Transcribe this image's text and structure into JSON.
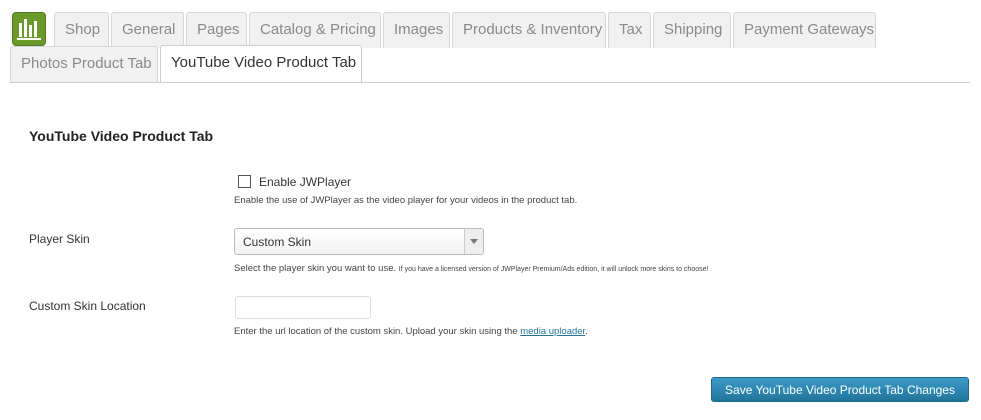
{
  "tabs_row1": [
    "Shop",
    "General",
    "Pages",
    "Catalog & Pricing",
    "Images",
    "Products & Inventory",
    "Tax",
    "Shipping",
    "Payment Gateways"
  ],
  "tabs_row2": [
    "Photos Product Tab",
    "YouTube Video Product Tab"
  ],
  "active_tab": "YouTube Video Product Tab",
  "section": {
    "title": "YouTube Video Product Tab"
  },
  "jwplayer": {
    "label": "Enable JWPlayer",
    "checked": false,
    "description": "Enable the use of JWPlayer as the video player for your videos in the product tab."
  },
  "player_skin": {
    "label": "Player Skin",
    "value": "Custom Skin",
    "description": "Select the player skin you want to use.",
    "note": "If you have a licensed version of JWPlayer Premium/Ads edition, it will unlock more skins to choose!"
  },
  "custom_skin": {
    "label": "Custom Skin Location",
    "value": "",
    "description": "Enter the url location of the custom skin. Upload your skin using the",
    "link_text": "media uploader",
    "description_end": "."
  },
  "save_button": "Save YouTube Video Product Tab Changes",
  "colors": {
    "accent": "#21759b",
    "logo_green": "#6a9b2a"
  }
}
